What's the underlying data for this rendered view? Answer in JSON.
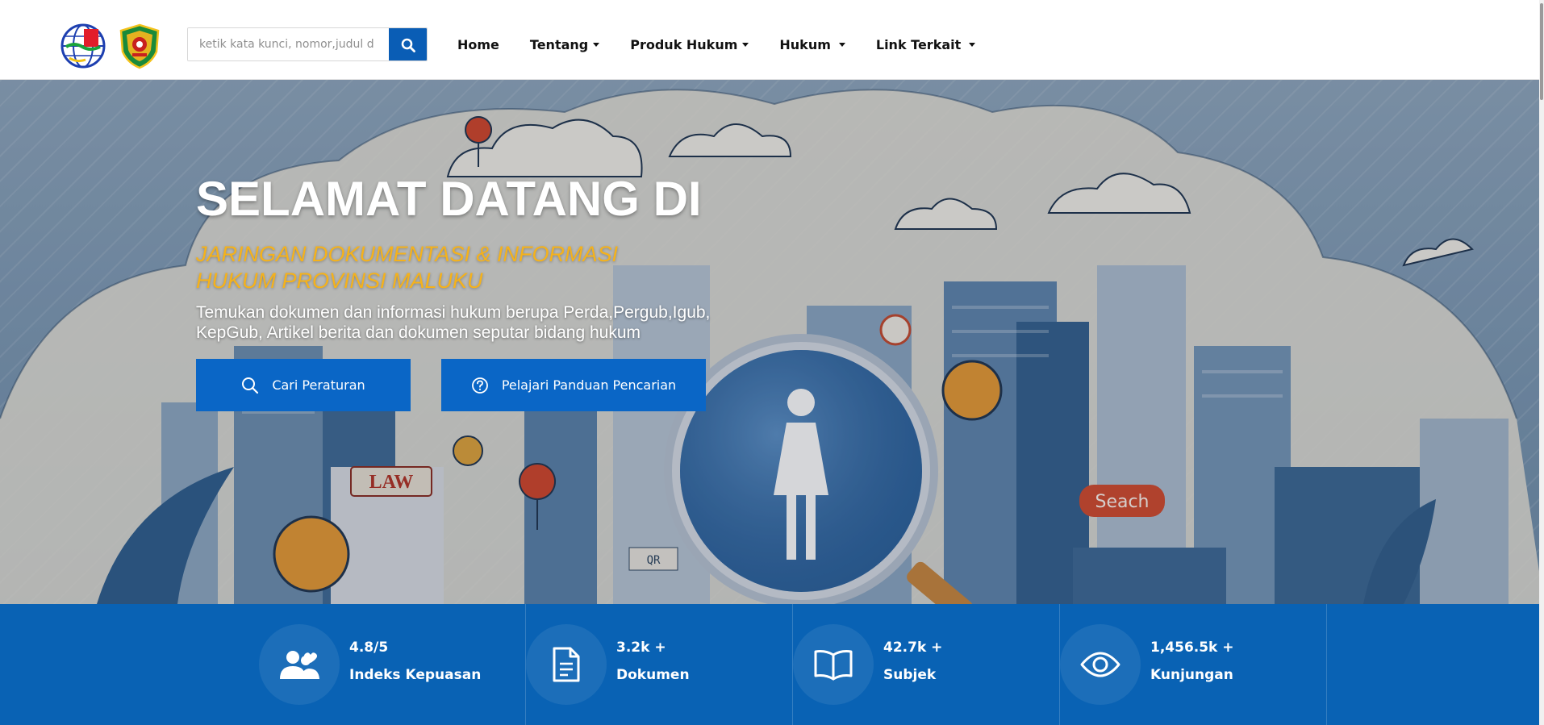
{
  "header": {
    "search": {
      "placeholder": "ketik kata kunci, nomor,judul d"
    },
    "menu": [
      {
        "label": "Home",
        "has_dropdown": false
      },
      {
        "label": "Tentang",
        "has_dropdown": true
      },
      {
        "label": "Produk Hukum",
        "has_dropdown": true
      },
      {
        "label": "Hukum",
        "has_dropdown": true
      },
      {
        "label": "Link Terkait",
        "has_dropdown": true
      }
    ]
  },
  "hero": {
    "title": "SELAMAT DATANG DI",
    "subtitle": "JARINGAN DOKUMENTASI & INFORMASI HUKUM PROVINSI MALUKU",
    "description": "Temukan dokumen dan informasi hukum berupa Perda,Pergub,Igub, KepGub, Artikel berita dan dokumen seputar bidang hukum",
    "buttons": {
      "search_label": "Cari Peraturan",
      "guide_label": "Pelajari Panduan Pencarian"
    },
    "illustration_text": {
      "law_sign": "LAW",
      "search_sign": "Seach",
      "qr_sign": "QR"
    }
  },
  "stats": [
    {
      "value": "4.8/5",
      "label": "Indeks Kepuasan",
      "icon": "users-heart-icon"
    },
    {
      "value": "3.2k +",
      "label": "Dokumen",
      "icon": "document-icon"
    },
    {
      "value": "42.7k +",
      "label": "Subjek",
      "icon": "book-icon"
    },
    {
      "value": "1,456.5k +",
      "label": "Kunjungan",
      "icon": "eye-icon"
    }
  ],
  "colors": {
    "primary_blue": "#0a5db5",
    "stats_bg": "#0962b4",
    "subtitle_yellow": "#f5b21b"
  }
}
